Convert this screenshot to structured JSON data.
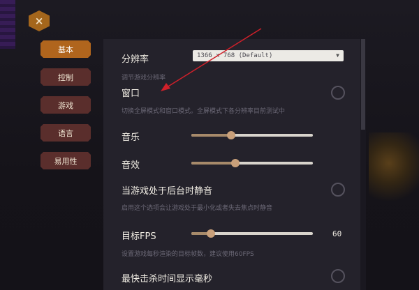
{
  "close_icon": "×",
  "tabs": [
    {
      "label": "基本",
      "active": true
    },
    {
      "label": "控制",
      "active": false
    },
    {
      "label": "游戏",
      "active": false
    },
    {
      "label": "语言",
      "active": false
    },
    {
      "label": "易用性",
      "active": false
    }
  ],
  "settings": {
    "resolution": {
      "label": "分辨率",
      "value": "1366 x 768 (Default)",
      "description": "调节游戏分辨率"
    },
    "window": {
      "label": "窗口",
      "description": "切换全屏模式和窗口模式。全屏模式下各分辨率目前测试中",
      "checked": false
    },
    "music": {
      "label": "音乐",
      "level": 0.33
    },
    "sfx": {
      "label": "音效",
      "level": 0.36
    },
    "mute_background": {
      "label": "当游戏处于后台时静音",
      "description": "启用这个选项会让游戏处于最小化或者失去焦点时静音",
      "checked": false
    },
    "target_fps": {
      "label": "目标FPS",
      "value": "60",
      "level": 0.16,
      "description": "设置游戏每秒渲染的目标帧数，建议使用60FPS"
    },
    "fastest_kill": {
      "label": "最快击杀时间显示毫秒",
      "checked": false
    }
  },
  "colors": {
    "accent": "#b0651d",
    "tab_inactive": "#5a2e2c",
    "panel": "#24222b",
    "annotation_arrow": "#d0202a"
  }
}
